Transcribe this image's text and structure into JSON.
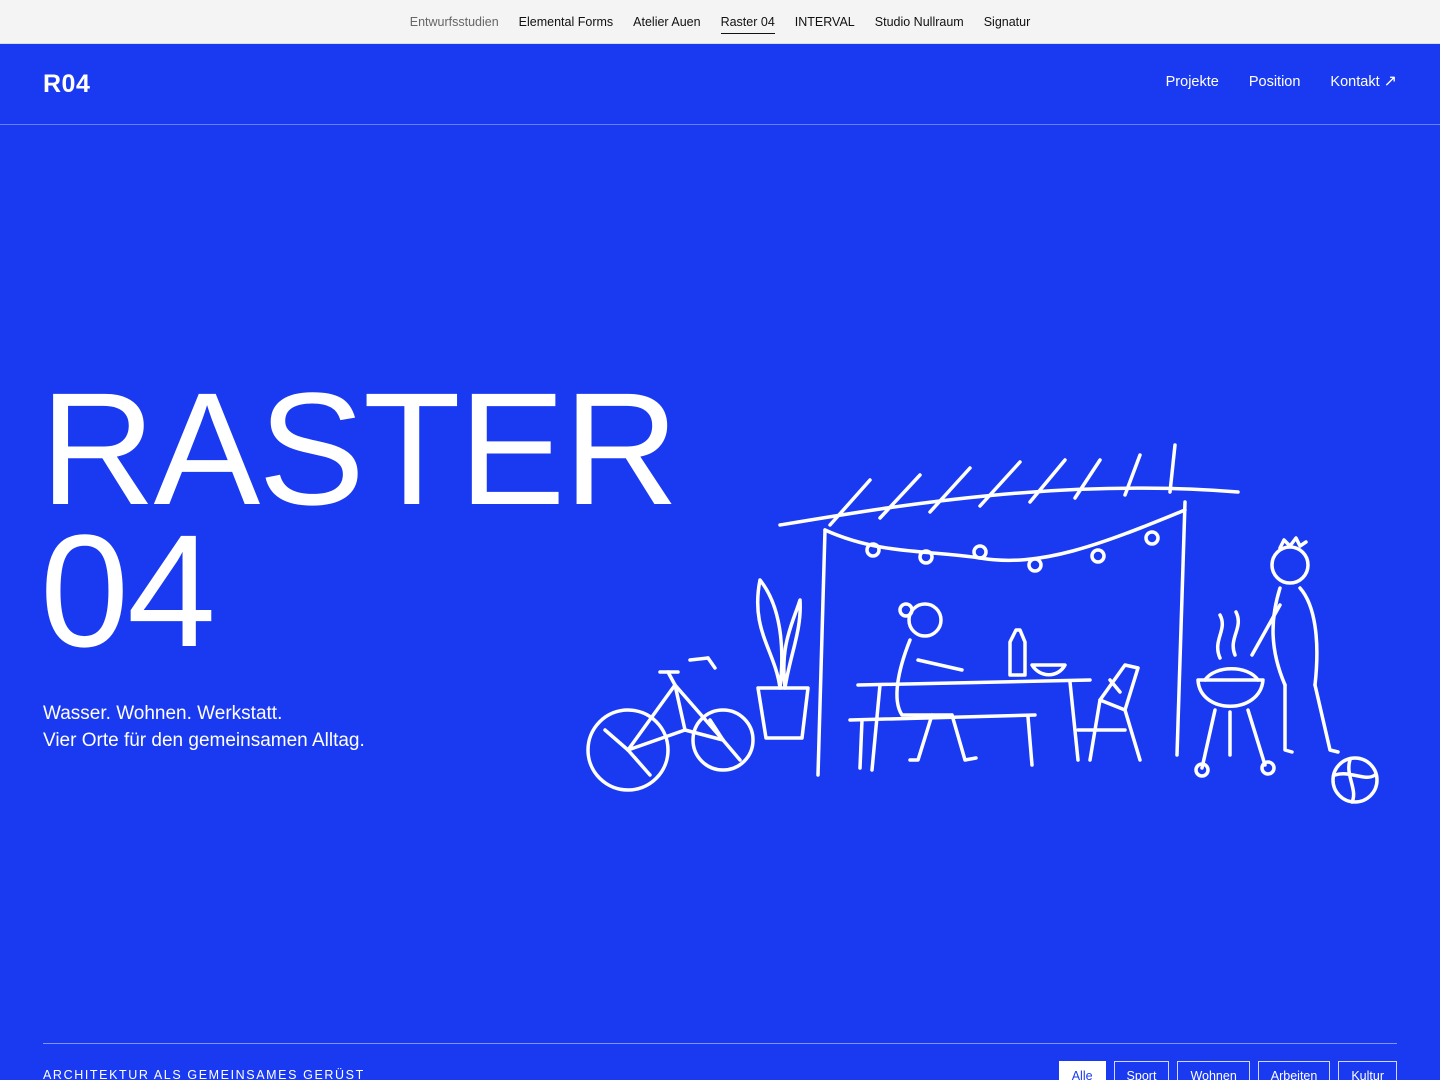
{
  "topbar": {
    "links": [
      {
        "label": "Entwurfsstudien"
      },
      {
        "label": "Elemental Forms"
      },
      {
        "label": "Atelier Auen"
      },
      {
        "label": "Raster 04",
        "active": true
      },
      {
        "label": "INTERVAL"
      },
      {
        "label": "Studio Nullraum"
      },
      {
        "label": "Signatur"
      }
    ]
  },
  "header": {
    "logo": "R04",
    "nav": [
      {
        "label": "Projekte"
      },
      {
        "label": "Position"
      },
      {
        "label": "Kontakt",
        "icon": "arrow-up-right-icon",
        "icon_glyph": "↗"
      }
    ]
  },
  "hero": {
    "title_line1": "RASTER",
    "title_line2": "04",
    "subtitle_line1": "Wasser. Wohnen. Werkstatt.",
    "subtitle_line2": "Vier Orte für den gemeinsamen Alltag."
  },
  "footer": {
    "tagline": "ARCHITEKTUR ALS GEMEINSAMES GERÜST",
    "filters": [
      {
        "label": "Alle",
        "active": true
      },
      {
        "label": "Sport"
      },
      {
        "label": "Wohnen"
      },
      {
        "label": "Arbeiten"
      },
      {
        "label": "Kultur"
      }
    ]
  },
  "colors": {
    "background": "#1a3af2",
    "topbar": "#f4f4f4",
    "text": "#ffffff"
  }
}
